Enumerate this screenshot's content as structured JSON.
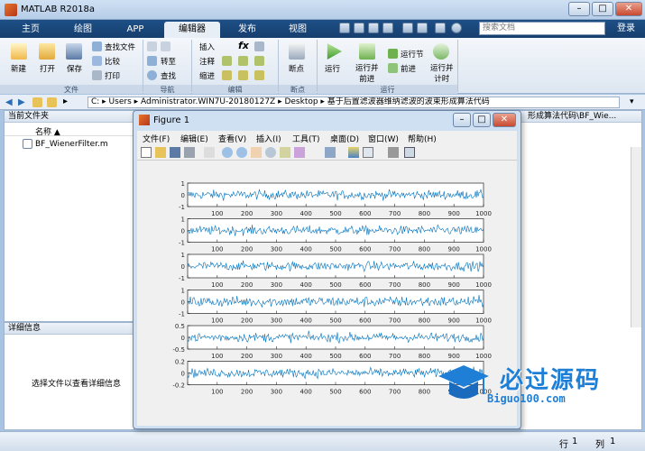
{
  "window": {
    "title": "MATLAB R2018a",
    "min": "–",
    "max": "□",
    "close": "✕"
  },
  "ribbon_tabs": [
    "主页",
    "绘图",
    "APP",
    "编辑器",
    "发布",
    "视图"
  ],
  "search_placeholder": "搜索文档",
  "login": "登录",
  "ribbon": {
    "file": {
      "new": "新建",
      "open": "打开",
      "save": "保存",
      "find_files": "查找文件",
      "compare": "比较",
      "print": "打印",
      "label": "文件"
    },
    "nav": {
      "goto": "转至",
      "find": "查找",
      "label": "导航"
    },
    "edit": {
      "insert": "插入",
      "comment": "注释",
      "indent": "缩进",
      "fx": "fx",
      "label": "编辑"
    },
    "breakpoints": {
      "bp": "断点",
      "label": "断点"
    },
    "run": {
      "run": "运行",
      "run_advance": "运行并\n前进",
      "run_section": "运行节",
      "advance": "前进",
      "run_time": "运行并\n计时",
      "label": "运行"
    }
  },
  "address": {
    "path": "C: ▸ Users ▸ Administrator.WIN7U-20180127Z ▸ Desktop ▸ 基于后置滤波器维纳滤波的波束形成算法代码"
  },
  "left_panel": {
    "title": "当前文件夹",
    "col_name": "名称 ▲",
    "file": "BF_WienerFilter.m"
  },
  "detail_panel": {
    "title": "详细信息",
    "hint": "选择文件以查看详细信息"
  },
  "right_panel": {
    "title": "形成算法代码\\BF_Wie..."
  },
  "status": {
    "row_label": "行",
    "row": "1",
    "col_label": "列",
    "col": "1"
  },
  "figure": {
    "title": "Figure 1",
    "menus": [
      "文件(F)",
      "编辑(E)",
      "查看(V)",
      "插入(I)",
      "工具(T)",
      "桌面(D)",
      "窗口(W)",
      "帮助(H)"
    ],
    "line_color": "#0072bd"
  },
  "chart_data": {
    "type": "line",
    "subplots": [
      {
        "ylim": [
          -1,
          1
        ],
        "yticks": [
          "1",
          "0",
          "-1"
        ],
        "amp": 0.6
      },
      {
        "ylim": [
          -1,
          1
        ],
        "yticks": [
          "1",
          "0",
          "-1"
        ],
        "amp": 0.6
      },
      {
        "ylim": [
          -1,
          1
        ],
        "yticks": [
          "1",
          "0",
          "-1"
        ],
        "amp": 0.6
      },
      {
        "ylim": [
          -1,
          1
        ],
        "yticks": [
          "1",
          "0",
          "-1"
        ],
        "amp": 0.7
      },
      {
        "ylim": [
          -0.5,
          0.5
        ],
        "yticks": [
          "0.5",
          "0",
          "-0.5"
        ],
        "amp": 0.3
      },
      {
        "ylim": [
          -0.2,
          0.2
        ],
        "yticks": [
          "0.2",
          "0",
          "-0.2"
        ],
        "amp": 0.12
      }
    ],
    "xlim": [
      0,
      1000
    ],
    "xticks": [
      0,
      100,
      200,
      300,
      400,
      500,
      600,
      700,
      800,
      900,
      1000
    ],
    "xticklabels": [
      "",
      "100",
      "200",
      "300",
      "400",
      "500",
      "600",
      "700",
      "800",
      "900",
      "1000"
    ]
  },
  "watermark": {
    "name": "必过源码",
    "site": "Biguo100.com"
  }
}
